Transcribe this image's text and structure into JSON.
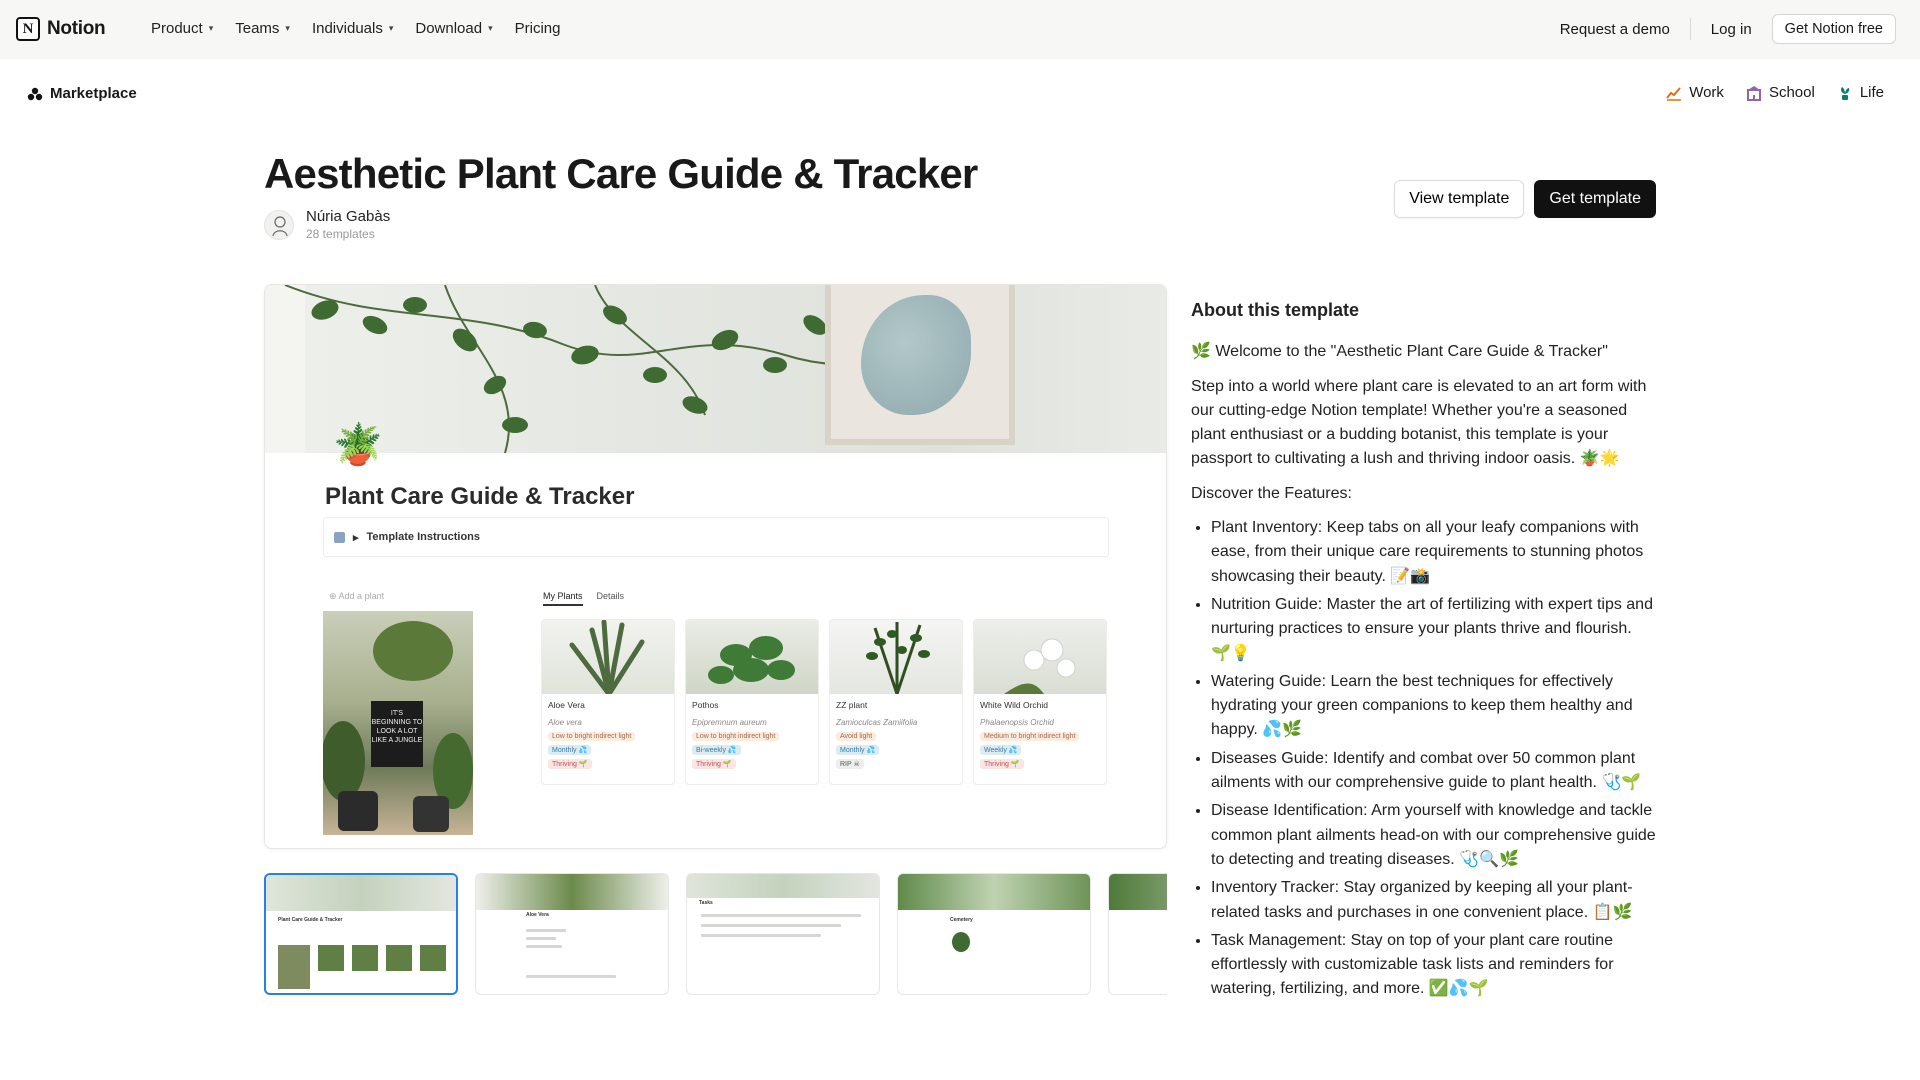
{
  "nav": {
    "brand": "Notion",
    "links": [
      {
        "label": "Product",
        "has_menu": true
      },
      {
        "label": "Teams",
        "has_menu": true
      },
      {
        "label": "Individuals",
        "has_menu": true
      },
      {
        "label": "Download",
        "has_menu": true
      },
      {
        "label": "Pricing",
        "has_menu": false
      }
    ],
    "request_demo": "Request a demo",
    "login": "Log in",
    "get_free": "Get Notion free"
  },
  "subnav": {
    "marketplace": "Marketplace",
    "categories": [
      {
        "label": "Work",
        "icon": "chart-icon",
        "color": "#d9730d"
      },
      {
        "label": "School",
        "icon": "building-icon",
        "color": "#9065b0"
      },
      {
        "label": "Life",
        "icon": "plant-icon",
        "color": "#0f7b6c"
      }
    ]
  },
  "template": {
    "title": "Aesthetic Plant Care Guide & Tracker",
    "author": "Núria Gabàs",
    "author_templates": "28 templates",
    "view_button": "View template",
    "get_button": "Get template"
  },
  "preview": {
    "page_title": "Plant Care Guide & Tracker",
    "instructions": "Template Instructions",
    "add_plant": "Add a plant",
    "tabs": [
      "My Plants",
      "Details"
    ],
    "photo_board_text": "IT'S BEGINNING TO LOOK A LOT LIKE A JUNGLE",
    "cards": [
      {
        "name": "Aloe Vera",
        "sci": "Aloe vera",
        "light": "Low to bright indirect light",
        "freq": "Monthly 💦",
        "status": "Thriving 🌱"
      },
      {
        "name": "Pothos",
        "sci": "Epipremnum aureum",
        "light": "Low to bright indirect light",
        "freq": "Bi-weekly 💦",
        "status": "Thriving 🌱"
      },
      {
        "name": "ZZ plant",
        "sci": "Zamioculcas Zamiifolia",
        "light": "Avoid light",
        "freq": "Monthly 💦",
        "status": "RIP ☠"
      },
      {
        "name": "White Wild Orchid",
        "sci": "Phalaenopsis Orchid",
        "light": "Medium to bright indirect light",
        "freq": "Weekly 💦",
        "status": "Thriving 🌱"
      }
    ],
    "thumbnails": 5,
    "active_thumbnail": 0,
    "thumb_labels": [
      "Plant Care Guide & Tracker",
      "Aloe Vera",
      "Tasks",
      "Cemetery"
    ]
  },
  "about": {
    "heading": "About this template",
    "welcome": "🌿 Welcome to the \"Aesthetic Plant Care Guide & Tracker\"",
    "intro": "Step into a world where plant care is elevated to an art form with our cutting-edge Notion template! Whether you're a seasoned plant enthusiast or a budding botanist, this template is your passport to cultivating a lush and thriving indoor oasis. 🪴🌟",
    "features_heading": "Discover the Features:",
    "features": [
      "Plant Inventory: Keep tabs on all your leafy companions with ease, from their unique care requirements to stunning photos showcasing their beauty. 📝📸",
      "Nutrition Guide: Master the art of fertilizing with expert tips and nurturing practices to ensure your plants thrive and flourish. 🌱💡",
      "Watering Guide: Learn the best techniques for effectively hydrating your green companions to keep them healthy and happy. 💦🌿",
      "Diseases Guide: Identify and combat over 50 common plant ailments with our comprehensive guide to plant health. 🩺🌱",
      "Disease Identification: Arm yourself with knowledge and tackle common plant ailments head-on with our comprehensive guide to detecting and treating diseases. 🩺🔍🌿",
      "Inventory Tracker: Stay organized by keeping all your plant-related tasks and purchases in one convenient place. 📋🌿",
      "Task Management: Stay on top of your plant care routine effortlessly with customizable task lists and reminders for watering, fertilizing, and more. ✅💦🌱"
    ]
  },
  "colors": {
    "nav_bg": "#f7f7f5",
    "primary_button": "#111111",
    "active_thumb_border": "#2383e2"
  }
}
